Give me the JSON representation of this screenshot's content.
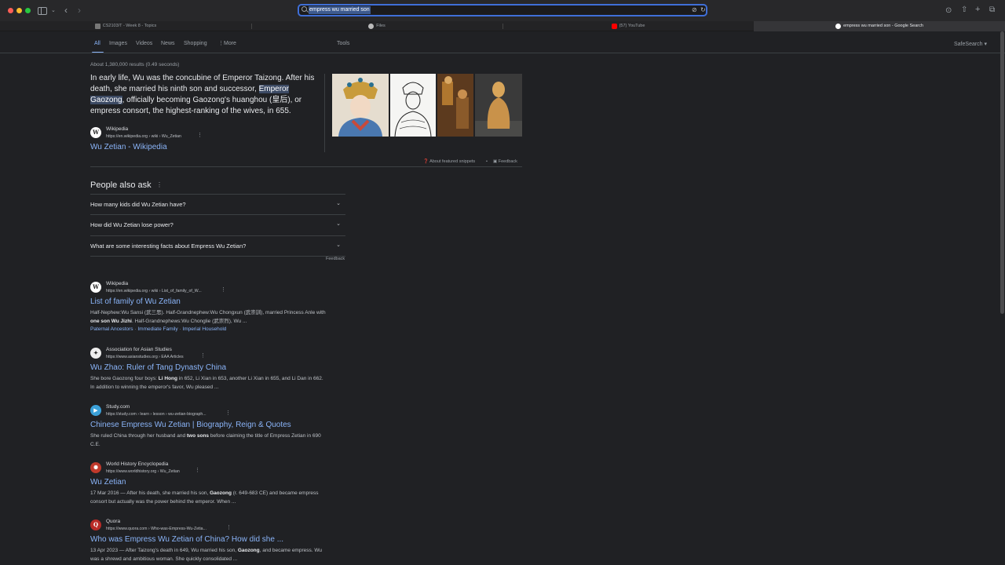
{
  "browser": {
    "address_text": "empress wu married son",
    "tabs": [
      {
        "label": "CS2103/T - Week 8 - Topics"
      },
      {
        "label": "Files"
      },
      {
        "label": "(57) YouTube"
      },
      {
        "label": "empress wu married son - Google Search"
      }
    ]
  },
  "nav": {
    "items": [
      "All",
      "Images",
      "Videos",
      "News",
      "Shopping",
      "More"
    ],
    "tools": "Tools",
    "safesearch": "SafeSearch"
  },
  "stats": "About 1,380,000 results (0.49 seconds)",
  "featured": {
    "text_1": "In early life, Wu was the concubine of Emperor Taizong. After his death, she married his ninth son and successor, ",
    "highlight": "Emperor Gaozong",
    "text_2": ", officially becoming Gaozong's huanghou (皇后), or empress consort, the highest-ranking of the wives, in 655.",
    "source_name": "Wikipedia",
    "source_url": "https://en.wikipedia.org › wiki › Wu_Zetian",
    "title": "Wu Zetian - Wikipedia",
    "about_label": "About featured snippets",
    "feedback_label": "Feedback"
  },
  "paa": {
    "title": "People also ask",
    "questions": [
      "How many kids did Wu Zetian have?",
      "How did Wu Zetian lose power?",
      "What are some interesting facts about Empress Wu Zetian?"
    ],
    "feedback": "Feedback"
  },
  "results": [
    {
      "source": "Wikipedia",
      "url": "https://en.wikipedia.org › wiki › List_of_family_of_W...",
      "title": "List of family of Wu Zetian",
      "desc_1": "Half-Nephew:Wu Sansi (武三思). Half-Grandnephew:Wu Chongxun (武崇訓), married Princess Anle with ",
      "desc_b1": "one son Wu Jizhi",
      "desc_2": ". Half-Grandnephews:Wu Chonglie (武崇烈), Wu ...",
      "sublinks": [
        "Paternal Ancestors",
        "Immediate Family",
        "Imperial Household"
      ]
    },
    {
      "source": "Association for Asian Studies",
      "url": "https://www.asianstudies.org › EAA Articles",
      "title": "Wu Zhao: Ruler of Tang Dynasty China",
      "desc_1": "She bore Gaozong four boys: ",
      "desc_b1": "Li Hong",
      "desc_2": " in 652, Li Xian in 653, another Li Xian in 655, and Li Dan in 662. In addition to winning the emperor's favor, Wu pleased ..."
    },
    {
      "source": "Study.com",
      "url": "https://study.com › learn › lesson › wu-zetian-biograph...",
      "title": "Chinese Empress Wu Zetian | Biography, Reign & Quotes",
      "desc_1": "She ruled China through her husband and ",
      "desc_b1": "two sons",
      "desc_2": " before claiming the title of Empress Zetian in 690 C.E."
    },
    {
      "source": "World History Encyclopedia",
      "url": "https://www.worldhistory.org › Wu_Zetian",
      "title": "Wu Zetian",
      "desc_1": "17 Mar 2016 — After his death, she married his son, ",
      "desc_b1": "Gaozong",
      "desc_2": " (r. 649-683 CE) and became empress consort but actually was the power behind the emperor. When ..."
    },
    {
      "source": "Quora",
      "url": "https://www.quora.com › Who-was-Empress-Wu-Zetia...",
      "title": "Who was Empress Wu Zetian of China? How did she ...",
      "desc_1": "13 Apr 2023 — After Taizong's death in 649, Wu married his son, ",
      "desc_b1": "Gaozong",
      "desc_2": ", and became empress. Wu was a shrewd and ambitious woman. She quickly consolidated ..."
    }
  ]
}
